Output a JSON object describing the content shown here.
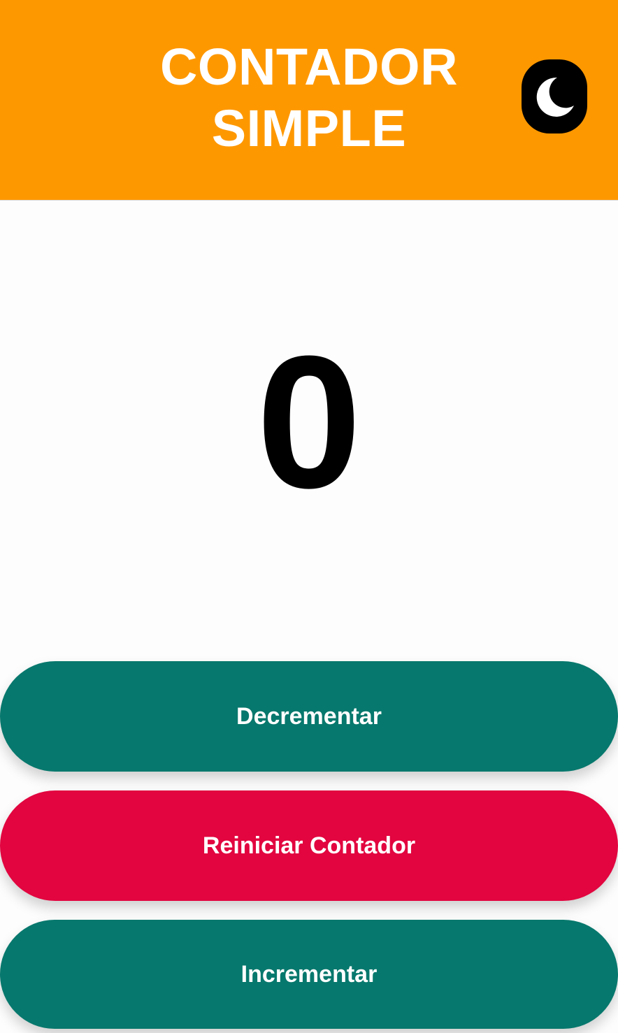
{
  "header": {
    "title_line1": "CONTADOR",
    "title_line2": "SIMPLE",
    "background_color": "#fe9800",
    "theme_toggle_icon": "moon-icon"
  },
  "counter": {
    "value": "0"
  },
  "buttons": {
    "decrement_label": "Decrementar",
    "reset_label": "Reiniciar Contador",
    "increment_label": "Incrementar",
    "primary_color": "#07786d",
    "danger_color": "#e2053f"
  }
}
